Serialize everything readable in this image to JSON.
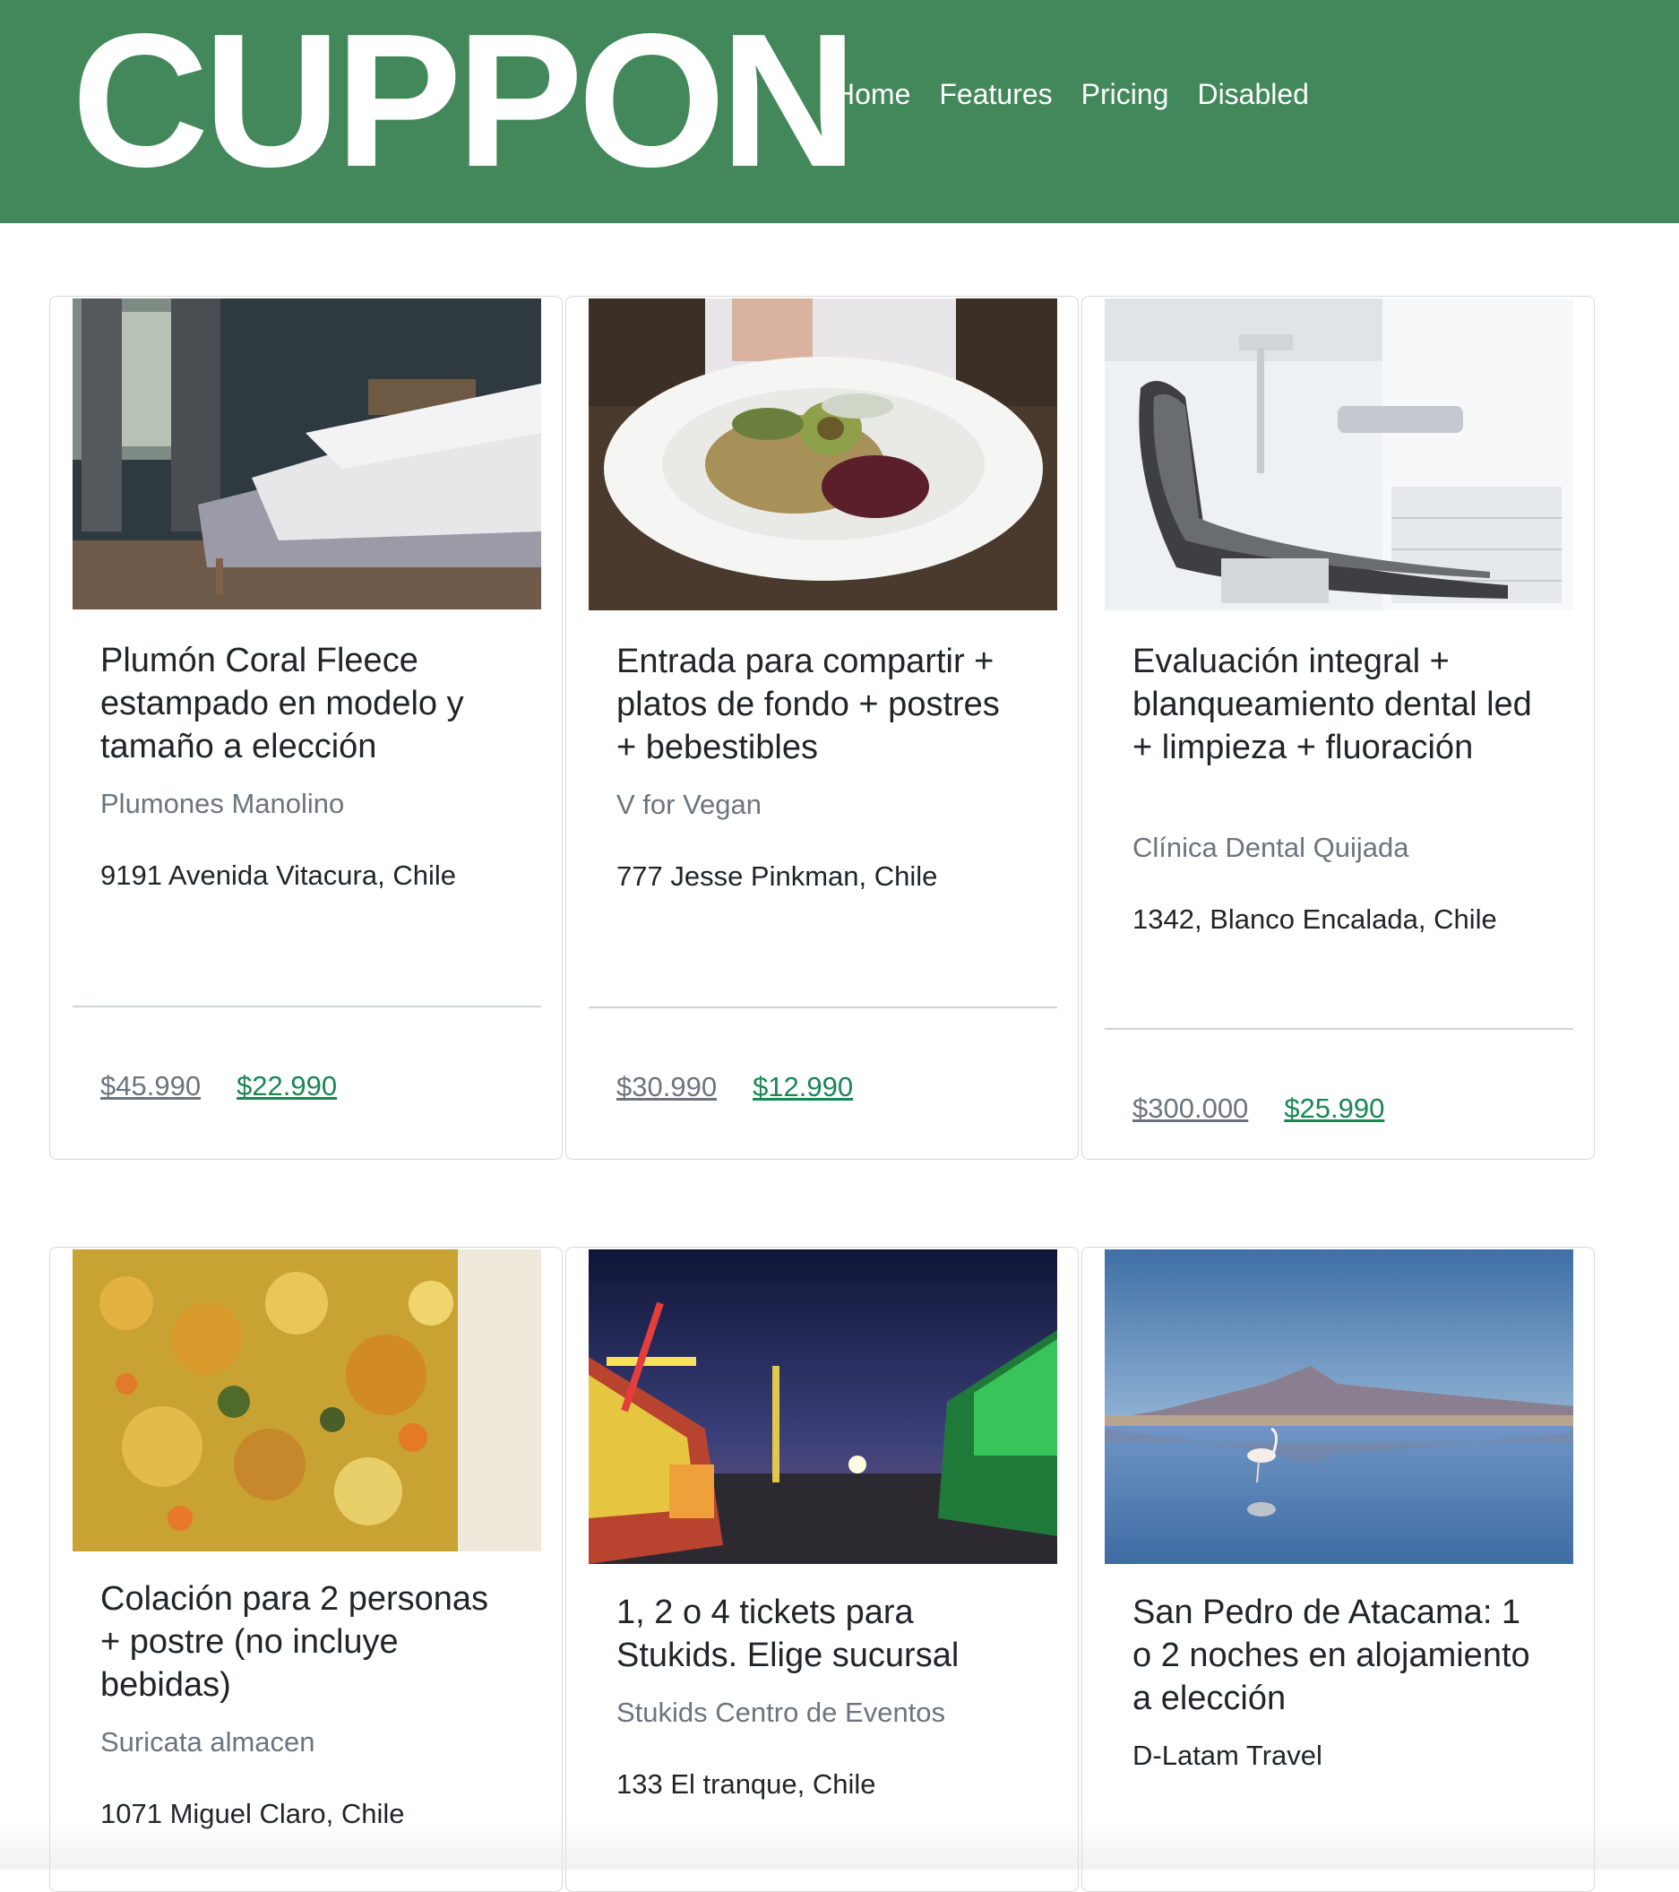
{
  "brand": "CUPPON",
  "nav": {
    "items": [
      {
        "label": "Home"
      },
      {
        "label": "Features"
      },
      {
        "label": "Pricing"
      },
      {
        "label": "Disabled"
      }
    ]
  },
  "colors": {
    "navbar": "#43885a",
    "price_new": "#198754",
    "muted": "#6c757d"
  },
  "cards": [
    {
      "image": "bedroom-photo",
      "title": "Plumón Coral Fleece estampado en modelo y tamaño a elección",
      "merchant": "Plumones Manolino",
      "address": "9191 Avenida Vitacura, Chile",
      "price_old": "$45.990",
      "price_new": "$22.990"
    },
    {
      "image": "vegan-dish-photo",
      "title": "Entrada para compartir + platos de fondo + postres + bebestibles",
      "merchant": "V for Vegan",
      "address": "777 Jesse Pinkman, Chile",
      "price_old": "$30.990",
      "price_new": "$12.990"
    },
    {
      "image": "dental-chair-photo",
      "title": "Evaluación integral + blanqueamiento dental led + limpieza + fluoración",
      "merchant": "Clínica Dental Quijada",
      "address": "1342, Blanco Encalada, Chile",
      "price_old": "$300.000",
      "price_new": "$25.990"
    },
    {
      "image": "vegetable-stew-photo",
      "title": "Colación para 2 personas + postre (no incluye bebidas)",
      "merchant": "Suricata almacen",
      "address": "1071 Miguel Claro, Chile"
    },
    {
      "image": "fairground-night-photo",
      "title": "1, 2 o 4 tickets para Stukids. Elige sucursal",
      "merchant": "Stukids Centro de Eventos",
      "address": "133 El tranque, Chile"
    },
    {
      "image": "flamingo-lagoon-photo",
      "title": "San Pedro de Atacama: 1 o 2 noches en alojamiento a elección",
      "merchant": "D-Latam Travel"
    }
  ]
}
